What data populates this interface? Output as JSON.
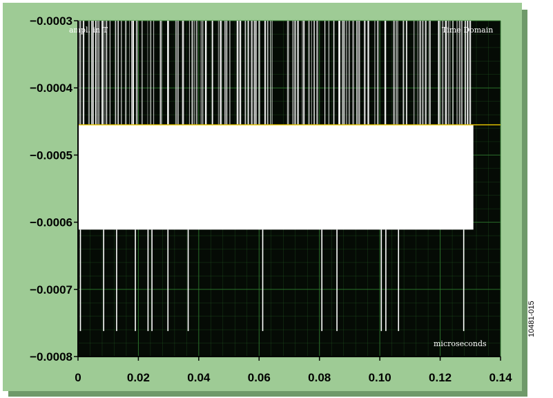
{
  "figure_number": "10481-015",
  "chart_data": {
    "type": "line",
    "title": "",
    "overlay_labels": {
      "top_left": "ampl. in T",
      "top_right": "Time Domain",
      "bottom_right": "microseconds"
    },
    "xlim": [
      0,
      0.14
    ],
    "ylim": [
      -0.0008,
      -0.0003
    ],
    "x_ticks": [
      "0",
      "0.02",
      "0.04",
      "0.06",
      "0.08",
      "0.10",
      "0.12",
      "0.14"
    ],
    "y_ticks": [
      "−0.0003",
      "−0.0004",
      "−0.0005",
      "−0.0006",
      "−0.0007",
      "−0.0008"
    ],
    "grid": true,
    "signal_extent_x": [
      0,
      0.131
    ],
    "upper_band": [
      -0.0003,
      -0.000455
    ],
    "core_band": [
      -0.000455,
      -0.000611
    ],
    "threshold_level": -0.000455,
    "lower_spikes": [
      {
        "x": 0.0008,
        "y": -0.000762
      },
      {
        "x": 0.0085,
        "y": -0.000762
      },
      {
        "x": 0.0128,
        "y": -0.000762
      },
      {
        "x": 0.019,
        "y": -0.000762
      },
      {
        "x": 0.0232,
        "y": -0.000762
      },
      {
        "x": 0.0245,
        "y": -0.000762
      },
      {
        "x": 0.0298,
        "y": -0.000762
      },
      {
        "x": 0.0365,
        "y": -0.000762
      },
      {
        "x": 0.0612,
        "y": -0.000762
      },
      {
        "x": 0.0808,
        "y": -0.000762
      },
      {
        "x": 0.0858,
        "y": -0.000762
      },
      {
        "x": 0.1005,
        "y": -0.000762
      },
      {
        "x": 0.102,
        "y": -0.000762
      },
      {
        "x": 0.1062,
        "y": -0.000762
      },
      {
        "x": 0.1278,
        "y": -0.000762
      }
    ],
    "colors": {
      "frame_background": "#9ecb95",
      "frame_shadow": "#6f9a6a",
      "plot_background": "#050b05",
      "grid": "#2f7a2f",
      "signal": "#ffffff",
      "threshold": "#e0c000",
      "axis_text": "#000000",
      "overlay_text": "#ffffff"
    }
  }
}
